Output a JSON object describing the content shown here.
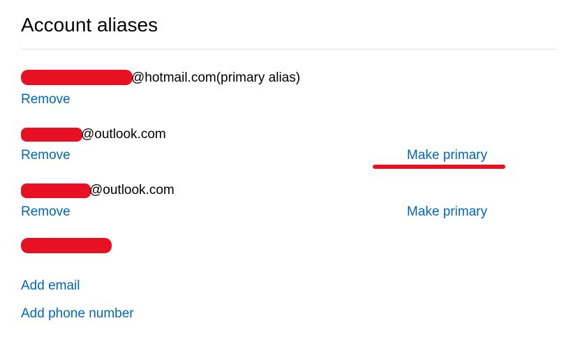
{
  "page": {
    "title": "Account aliases"
  },
  "aliases": [
    {
      "domain": "@hotmail.com",
      "suffix": " (primary alias)",
      "remove": "Remove",
      "make_primary": "",
      "redact_class": "w-large",
      "show_underline": false
    },
    {
      "domain": "@outlook.com",
      "suffix": "",
      "remove": "Remove",
      "make_primary": "Make primary",
      "redact_class": "w-med",
      "show_underline": true
    },
    {
      "domain": "@outlook.com",
      "suffix": "",
      "remove": "Remove",
      "make_primary": "Make primary",
      "redact_class": "w-med2",
      "show_underline": false
    }
  ],
  "extra_redacted": true,
  "actions": {
    "add_email": "Add email",
    "add_phone": "Add phone number"
  },
  "colors": {
    "link": "#0067b8",
    "redact": "#e81123"
  }
}
